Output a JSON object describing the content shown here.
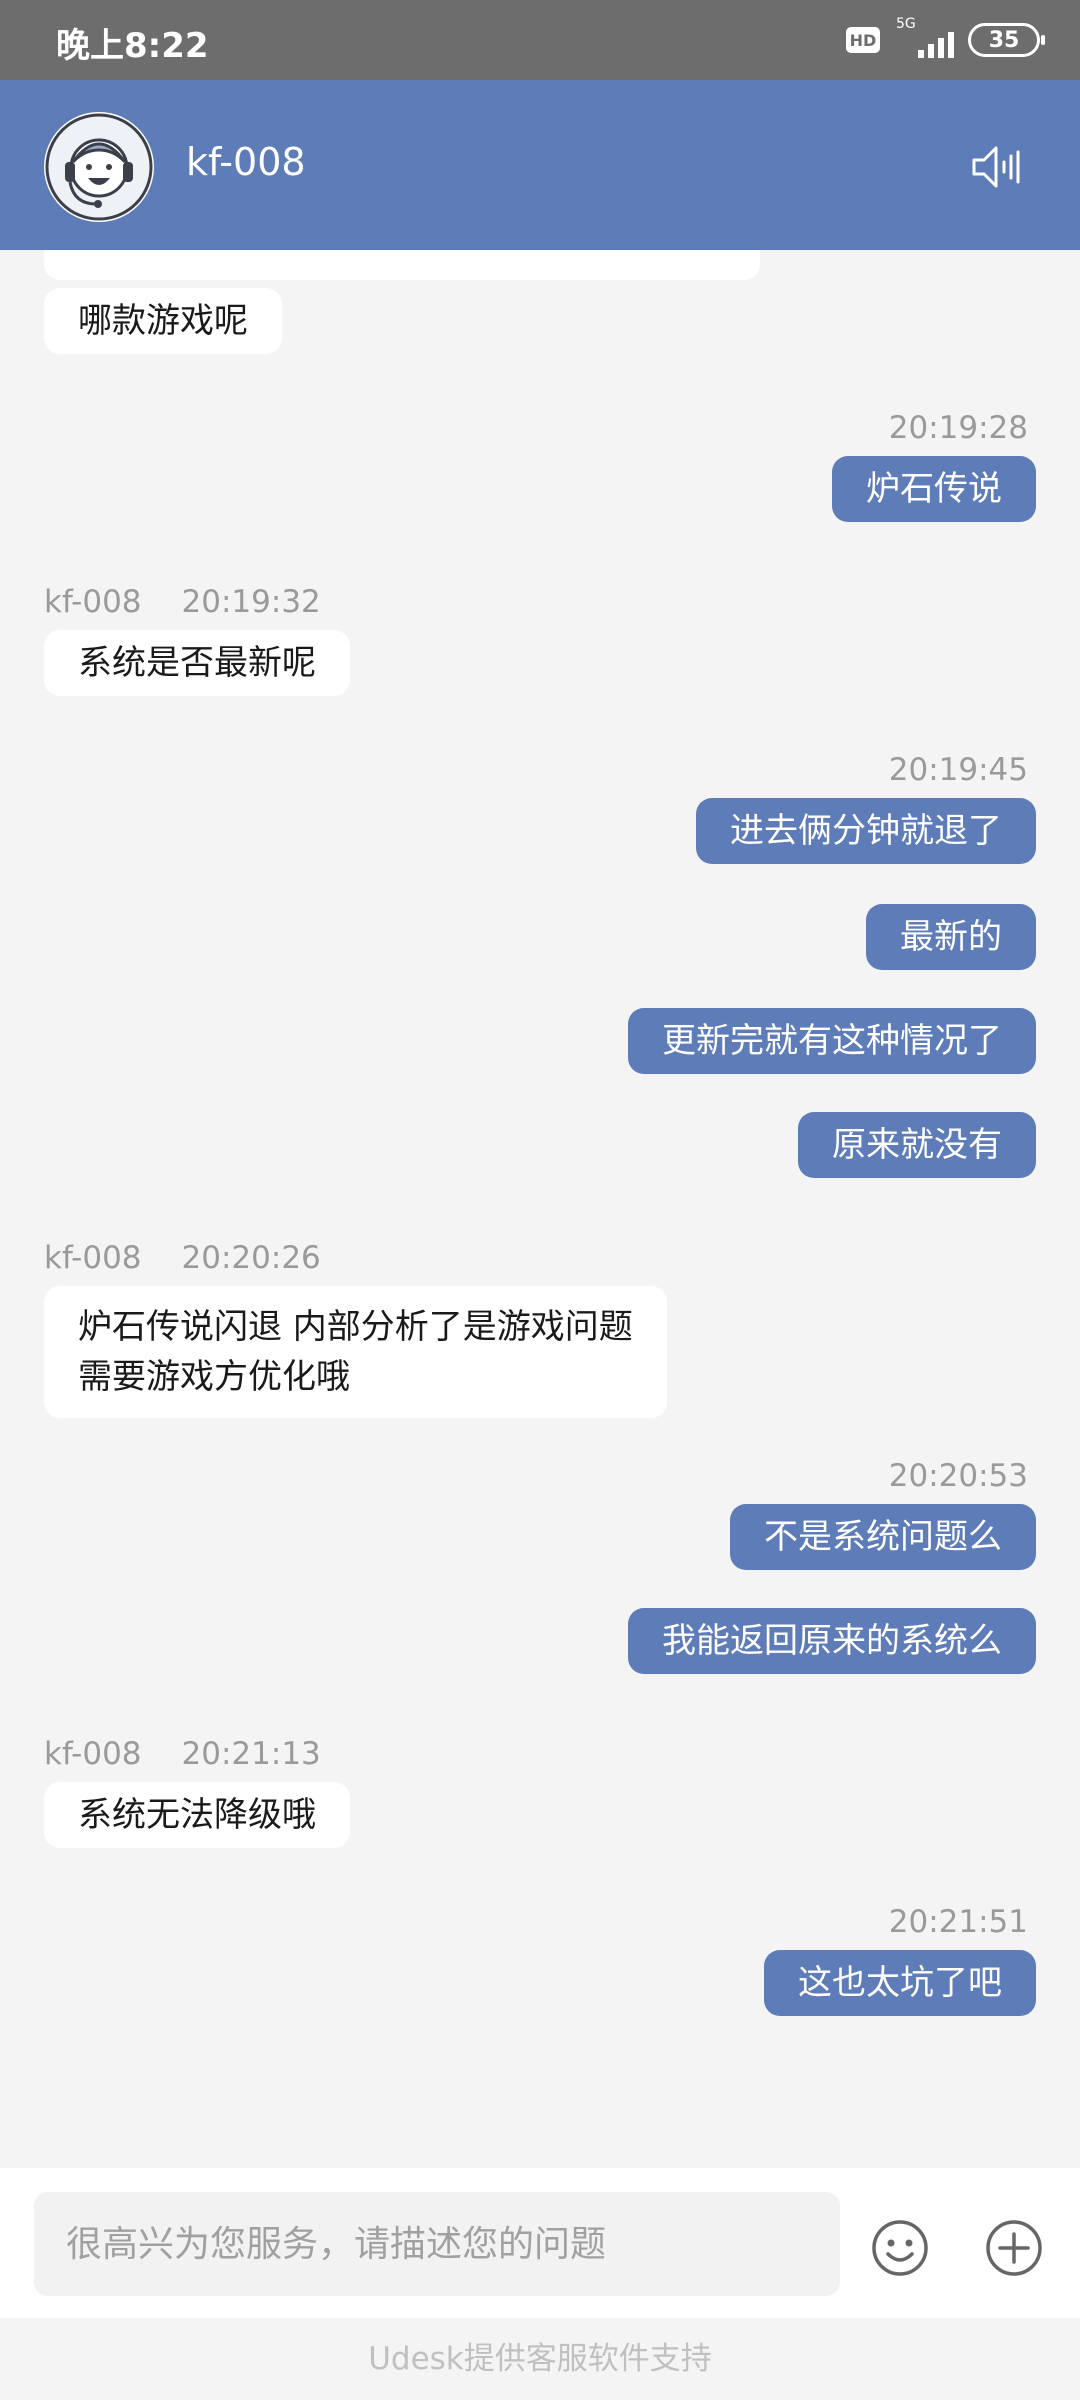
{
  "status_bar": {
    "time": "晚上8:22",
    "hd_badge": "HD",
    "network": "5G",
    "battery": "35"
  },
  "header": {
    "title": "kf-008",
    "avatar_icon": "agent-headset-avatar",
    "speaker_icon": "speaker-icon",
    "bg_color": "#5e7db8"
  },
  "messages": {
    "m1": {
      "side": "left",
      "text": "哪款游戏呢"
    },
    "t1": {
      "time": "20:19:28"
    },
    "m2": {
      "side": "right",
      "text": "炉石传说"
    },
    "g1": {
      "sender": "kf-008",
      "time": "20:19:32"
    },
    "m3": {
      "side": "left",
      "text": "系统是否最新呢"
    },
    "t2": {
      "time": "20:19:45"
    },
    "m4": {
      "side": "right",
      "text": "进去俩分钟就退了"
    },
    "m5": {
      "side": "right",
      "text": "最新的"
    },
    "m6": {
      "side": "right",
      "text": "更新完就有这种情况了"
    },
    "m7": {
      "side": "right",
      "text": "原来就没有"
    },
    "g2": {
      "sender": "kf-008",
      "time": "20:20:26"
    },
    "m8": {
      "side": "left",
      "text": "炉石传说闪退 内部分析了是游戏问题\n需要游戏方优化哦"
    },
    "t3": {
      "time": "20:20:53"
    },
    "m9": {
      "side": "right",
      "text": "不是系统问题么"
    },
    "m10": {
      "side": "right",
      "text": "我能返回原来的系统么"
    },
    "g3": {
      "sender": "kf-008",
      "time": "20:21:13"
    },
    "m11": {
      "side": "left",
      "text": "系统无法降级哦"
    },
    "t4": {
      "time": "20:21:51"
    },
    "m12": {
      "side": "right",
      "text": "这也太坑了吧"
    }
  },
  "input": {
    "placeholder": "很高兴为您服务，请描述您的问题",
    "emoji_icon": "emoji-icon",
    "plus_icon": "plus-icon"
  },
  "footer": {
    "text": "Udesk提供客服软件支持"
  },
  "colors": {
    "accent": "#5e7db8",
    "background": "#f4f4f4",
    "status_bar": "#6d6d6d"
  }
}
